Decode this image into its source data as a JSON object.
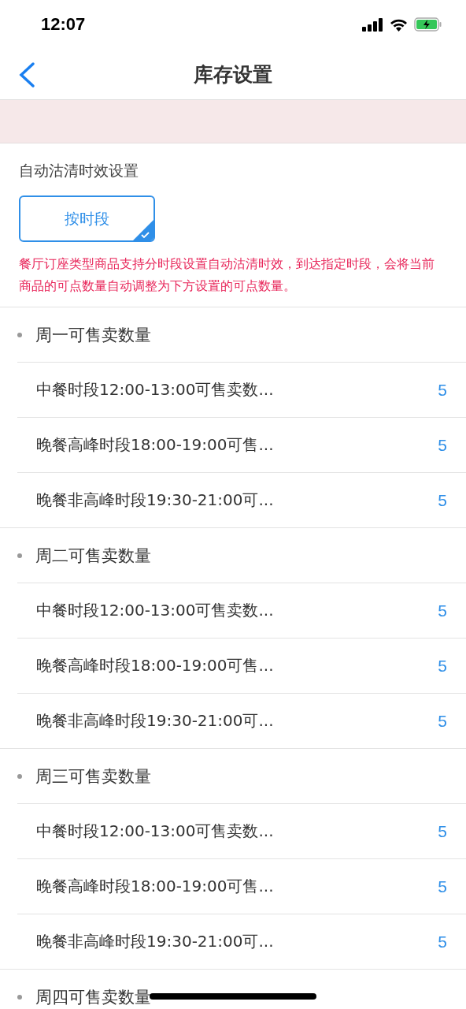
{
  "status_bar": {
    "time": "12:07"
  },
  "nav": {
    "title": "库存设置"
  },
  "section": {
    "title": "自动沽清时效设置",
    "options": [
      {
        "label": "按时段",
        "selected": true
      }
    ],
    "note": "餐厅订座类型商品支持分时段设置自动沽清时效，到达指定时段，会将当前商品的可点数量自动调整为下方设置的可点数量。"
  },
  "days": [
    {
      "title": "周一可售卖数量",
      "items": [
        {
          "label": "中餐时段12:00-13:00可售卖数...",
          "value": "5"
        },
        {
          "label": "晚餐高峰时段18:00-19:00可售...",
          "value": "5"
        },
        {
          "label": "晚餐非高峰时段19:30-21:00可...",
          "value": "5"
        }
      ]
    },
    {
      "title": "周二可售卖数量",
      "items": [
        {
          "label": "中餐时段12:00-13:00可售卖数...",
          "value": "5"
        },
        {
          "label": "晚餐高峰时段18:00-19:00可售...",
          "value": "5"
        },
        {
          "label": "晚餐非高峰时段19:30-21:00可...",
          "value": "5"
        }
      ]
    },
    {
      "title": "周三可售卖数量",
      "items": [
        {
          "label": "中餐时段12:00-13:00可售卖数...",
          "value": "5"
        },
        {
          "label": "晚餐高峰时段18:00-19:00可售...",
          "value": "5"
        },
        {
          "label": "晚餐非高峰时段19:30-21:00可...",
          "value": "5"
        }
      ]
    },
    {
      "title": "周四可售卖数量"
    }
  ]
}
